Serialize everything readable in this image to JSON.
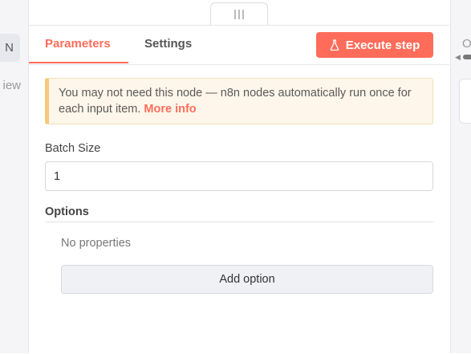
{
  "left_panel": {
    "active_tab_label": "N",
    "second_tab_label": "iew"
  },
  "right_panel": {
    "label": "O"
  },
  "tabs": [
    {
      "label": "Parameters",
      "active": true
    },
    {
      "label": "Settings",
      "active": false
    }
  ],
  "execute_button": {
    "label": "Execute step",
    "icon": "flask-icon"
  },
  "notice": {
    "text": "You may not need this node — n8n nodes automatically run once for each input item.",
    "link": "More info"
  },
  "batch_size": {
    "label": "Batch Size",
    "value": "1"
  },
  "options": {
    "label": "Options",
    "empty_text": "No properties",
    "add_button": "Add option"
  },
  "colors": {
    "accent": "#ff6d5a",
    "notice_bg": "#fef6ea",
    "notice_border": "#f7c877"
  }
}
